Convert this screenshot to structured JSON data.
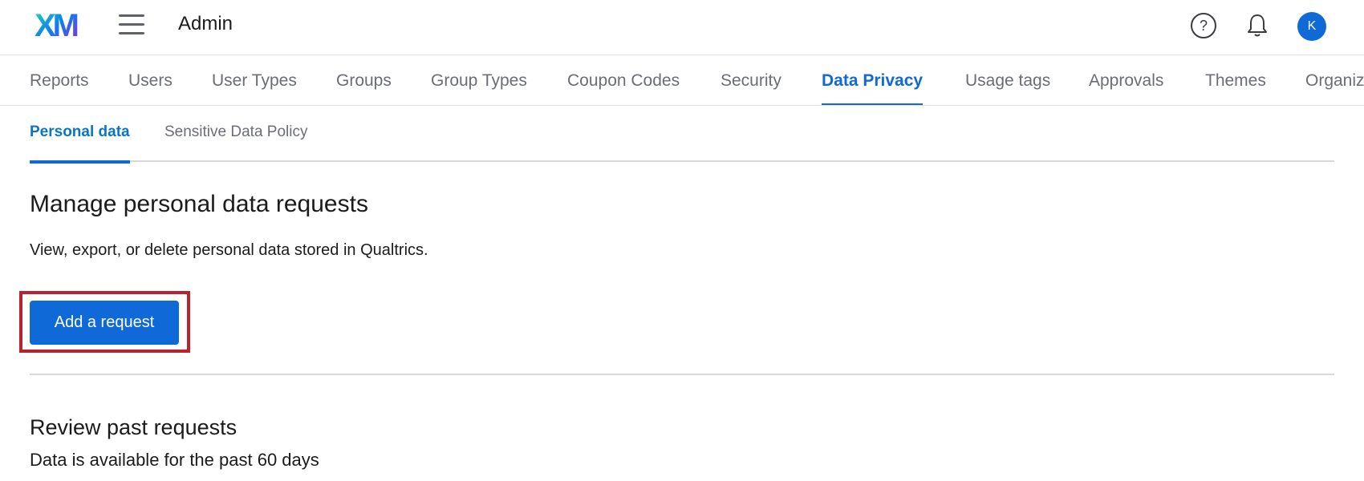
{
  "header": {
    "logo_text": "XM",
    "title": "Admin",
    "avatar_initial": "K",
    "icons": [
      "menu-icon",
      "help-icon",
      "bell-icon"
    ]
  },
  "main_tabs": [
    {
      "label": "Reports"
    },
    {
      "label": "Users"
    },
    {
      "label": "User Types"
    },
    {
      "label": "Groups"
    },
    {
      "label": "Group Types"
    },
    {
      "label": "Coupon Codes"
    },
    {
      "label": "Security"
    },
    {
      "label": "Data Privacy",
      "active": true
    },
    {
      "label": "Usage tags"
    },
    {
      "label": "Approvals"
    },
    {
      "label": "Themes"
    },
    {
      "label": "Organiz"
    }
  ],
  "sub_tabs": [
    {
      "label": "Personal data",
      "active": true
    },
    {
      "label": "Sensitive Data Policy"
    }
  ],
  "manage": {
    "title": "Manage personal data requests",
    "description": "View, export, or delete personal data stored in Qualtrics.",
    "add_button_label": "Add a request"
  },
  "review": {
    "title": "Review past requests",
    "subtitle": "Data is available for the past 60 days"
  },
  "colors": {
    "accent": "#0f6ad7",
    "highlight": "#b8232f",
    "muted_text": "#6b6d74"
  }
}
